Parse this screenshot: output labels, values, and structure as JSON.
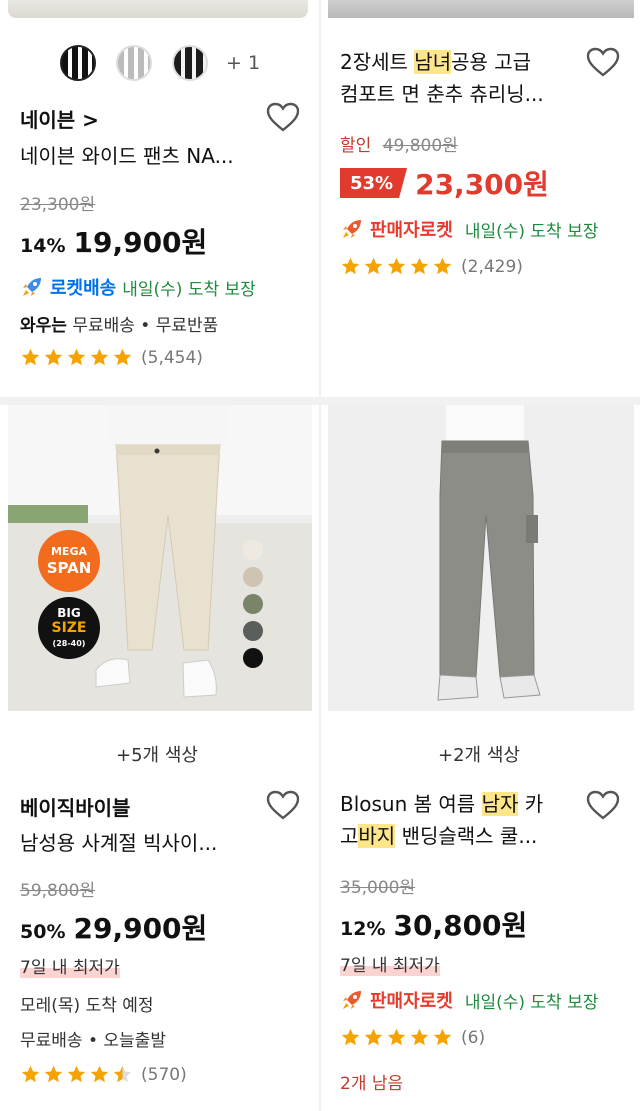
{
  "products": [
    {
      "brand": "네이븐 >",
      "title": "네이븐 와이드 팬츠 NA...",
      "swatch_more": "+ 1",
      "orig_price": "23,300원",
      "discount": "14%",
      "price": "19,900원",
      "delivery": "로켓배송",
      "arrival": "내일(수) 도착 보장",
      "wow_label": "와우는",
      "wow_text": "무료배송 • 무료반품",
      "rating": 5,
      "reviews": "(5,454)"
    },
    {
      "title_line1_a": "2장세트 ",
      "title_line1_hl": "남녀",
      "title_line1_b": "공용 고급",
      "title_line2": "컴포트 면 춘추 츄리닝...",
      "sale_label": "할인",
      "orig_price": "49,800원",
      "discount": "53%",
      "price": "23,300원",
      "delivery": "판매자로켓",
      "arrival": "내일(수) 도착 보장",
      "rating": 5,
      "reviews": "(2,429)"
    },
    {
      "badge_mega_1": "MEGA",
      "badge_mega_2": "SPAN",
      "badge_big_1": "BIG",
      "badge_big_2": "SIZE",
      "badge_big_3": "(28-40)",
      "colors_count": "+5개 색상",
      "brand": "베이직바이블",
      "title": "남성용 사계절 빅사이...",
      "orig_price": "59,800원",
      "discount": "50%",
      "price": "29,900원",
      "lowest": "7일 내 최저가",
      "arrival_text": "모레(목) 도착 예정",
      "shipping": "무료배송 • 오늘출발",
      "rating": 4.5,
      "reviews": "(570)"
    },
    {
      "colors_count": "+2개 색상",
      "title_line1_a": "Blosun 봄 여름 ",
      "title_line1_hl": "남자",
      "title_line1_b": " 카",
      "title_line2_a": "고",
      "title_line2_hl": "바지",
      "title_line2_b": " 밴딩슬랙스 쿨...",
      "orig_price": "35,000원",
      "discount": "12%",
      "price": "30,800원",
      "lowest": "7일 내 최저가",
      "delivery": "판매자로켓",
      "arrival": "내일(수) 도착 보장",
      "rating": 5,
      "reviews": "(6)",
      "stock": "2개 남음"
    }
  ],
  "colors": {
    "rocket_blue": "#0073e9",
    "seller_red": "#e83a2c",
    "arrival_green": "#1f8a3d",
    "star": "#f5a300",
    "sale_red": "#e23b2e"
  },
  "icons": [
    "heart-icon",
    "rocket-icon",
    "star-icon"
  ]
}
